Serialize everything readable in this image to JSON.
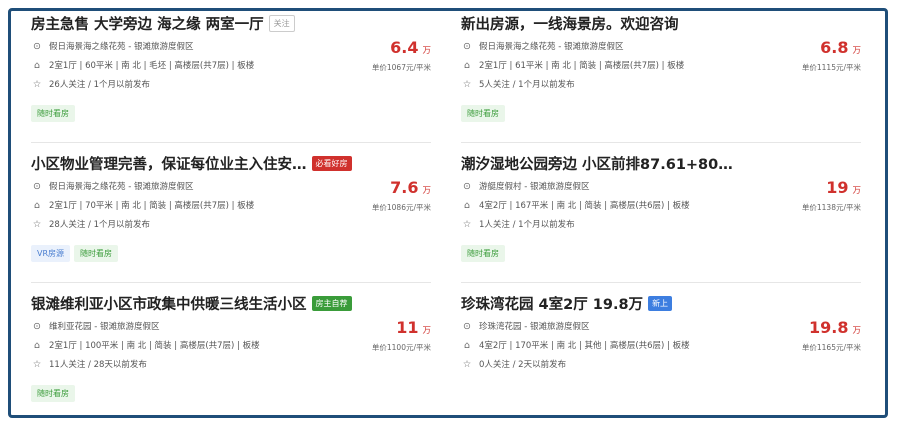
{
  "listings": [
    {
      "title": "房主急售 大学旁边 海之缘 两室一厅",
      "tag": "关注",
      "location": "假日海景海之缘花苑 - 银滩旅游度假区",
      "details": "2室1厅 | 60平米 | 南 北 | 毛坯 | 高楼层(共7层) | 板楼",
      "followers": "26人关注 / 1个月以前发布",
      "price": "6.4",
      "price_unit": "万",
      "unit_price": "单价1067元/平米",
      "pills": [
        "随时看房"
      ]
    },
    {
      "title": "新出房源，一线海景房。欢迎咨询",
      "tag": "",
      "location": "假日海景海之缘花苑 - 银滩旅游度假区",
      "details": "2室1厅 | 61平米 | 南 北 | 简装 | 高楼层(共7层) | 板楼",
      "followers": "5人关注 / 1个月以前发布",
      "price": "6.8",
      "price_unit": "万",
      "unit_price": "单价1115元/平米",
      "pills": [
        "随时看房"
      ]
    },
    {
      "title": "小区物业管理完善，保证每位业主入住安…",
      "tag": "必看好房",
      "location": "假日海景海之缘花苑 - 银滩旅游度假区",
      "details": "2室1厅 | 70平米 | 南 北 | 简装 | 高楼层(共7层) | 板楼",
      "followers": "28人关注 / 1个月以前发布",
      "price": "7.6",
      "price_unit": "万",
      "unit_price": "单价1086元/平米",
      "pills": [
        "VR房源",
        "随时看房"
      ]
    },
    {
      "title": "潮汐湿地公园旁边 小区前排87.61+80…",
      "tag": "",
      "location": "游艇度假村 - 银滩旅游度假区",
      "details": "4室2厅 | 167平米 | 南 北 | 简装 | 高楼层(共6层) | 板楼",
      "followers": "1人关注 / 1个月以前发布",
      "price": "19",
      "price_unit": "万",
      "unit_price": "单价1138元/平米",
      "pills": [
        "随时看房"
      ]
    },
    {
      "title": "银滩维利亚小区市政集中供暖三线生活小区",
      "tag": "房主自荐",
      "location": "维利亚花园 - 银滩旅游度假区",
      "details": "2室1厅 | 100平米 | 南 北 | 简装 | 高楼层(共7层) | 板楼",
      "followers": "11人关注 / 28天以前发布",
      "price": "11",
      "price_unit": "万",
      "unit_price": "单价1100元/平米",
      "pills": [
        "随时看房"
      ]
    },
    {
      "title": "珍珠湾花园 4室2厅 19.8万",
      "tag": "新上",
      "location": "珍珠湾花园 - 银滩旅游度假区",
      "details": "4室2厅 | 170平米 | 南 北 | 其他 | 高楼层(共6层) | 板楼",
      "followers": "0人关注 / 2天以前发布",
      "price": "19.8",
      "price_unit": "万",
      "unit_price": "单价1165元/平米",
      "pills": []
    }
  ],
  "colors": {
    "frame": "#1f4e79",
    "price": "#d0312d",
    "pill_green": "#3a9c3a",
    "pill_blue": "#4a7ed0"
  },
  "icons": {
    "location": "location-pin-icon",
    "house": "house-icon",
    "star": "star-icon"
  }
}
